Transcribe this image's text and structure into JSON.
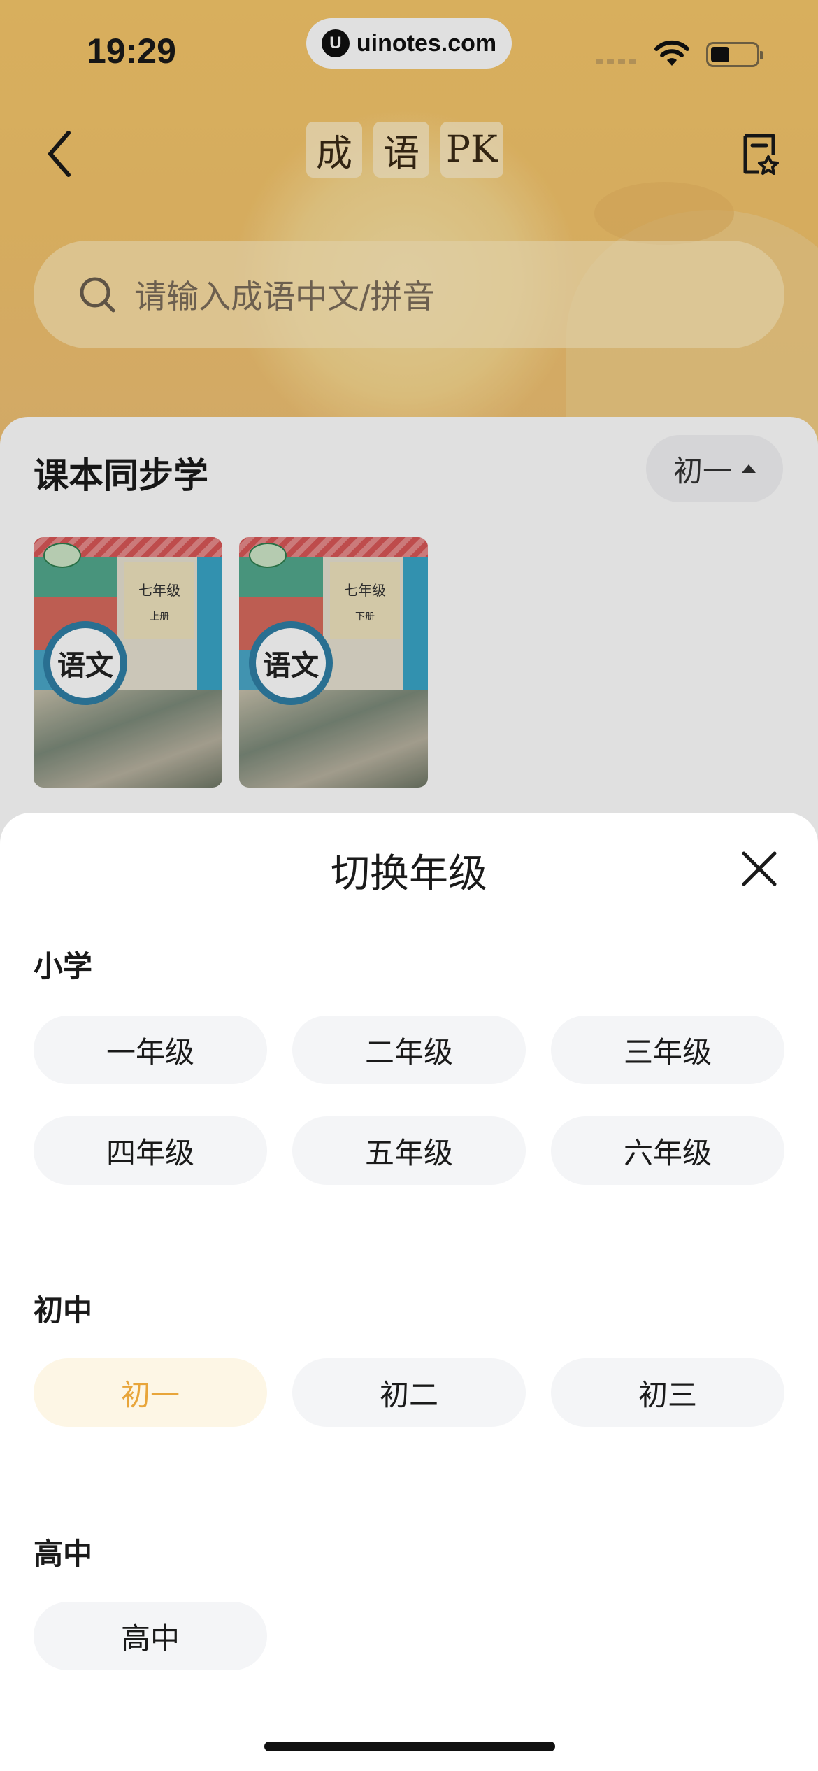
{
  "status_bar": {
    "time": "19:29",
    "url": "uinotes.com",
    "url_logo": "U"
  },
  "nav": {
    "title_chars": [
      "成",
      "语",
      "PK"
    ]
  },
  "search": {
    "placeholder": "请输入成语中文/拼音"
  },
  "textbook": {
    "section_title": "课本同步学",
    "current_grade": "初一",
    "books": [
      {
        "grade": "七年级",
        "volume": "上册",
        "subject": "语文"
      },
      {
        "grade": "七年级",
        "volume": "下册",
        "subject": "语文"
      }
    ]
  },
  "sheet": {
    "title": "切换年级",
    "groups": [
      {
        "label": "小学",
        "options": [
          "一年级",
          "二年级",
          "三年级",
          "四年级",
          "五年级",
          "六年级"
        ]
      },
      {
        "label": "初中",
        "options": [
          "初一",
          "初二",
          "初三"
        ]
      },
      {
        "label": "高中",
        "options": [
          "高中"
        ]
      }
    ],
    "selected": "初一"
  },
  "colors": {
    "accent": "#e8a53a",
    "selected_bg": "#fdf6e5",
    "chip_bg": "#f4f5f7",
    "hero_bg": "#f6c86a"
  }
}
